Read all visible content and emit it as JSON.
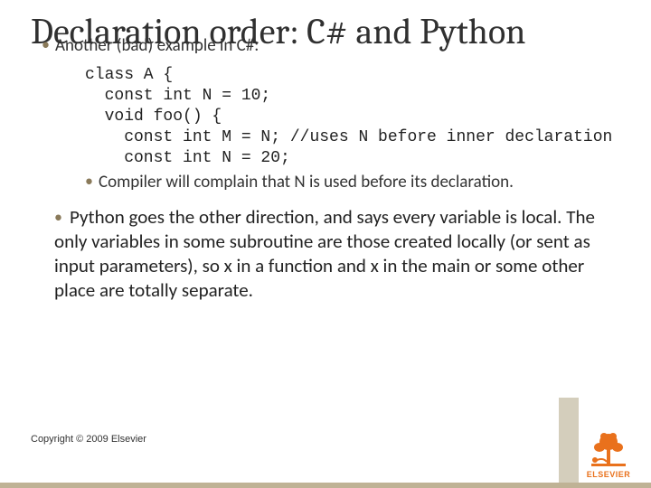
{
  "title": "Declaration order: C# and Python",
  "bullet1": "Another (bad) example in C#:",
  "code": "class A {\n  const int N = 10;\n  void foo() {\n    const int M = N; //uses N before inner declaration\n    const int N = 20;",
  "subbullet": "Compiler will complain that N is used before its declaration.",
  "outer_bullet": "Python goes the other direction, and says every variable is local.  The only variables in some subroutine are those created locally (or sent as input parameters), so x in a function and x in the main or some other place are totally separate.",
  "copyright": "Copyright © 2009 Elsevier",
  "logo_text": "ELSEVIER"
}
